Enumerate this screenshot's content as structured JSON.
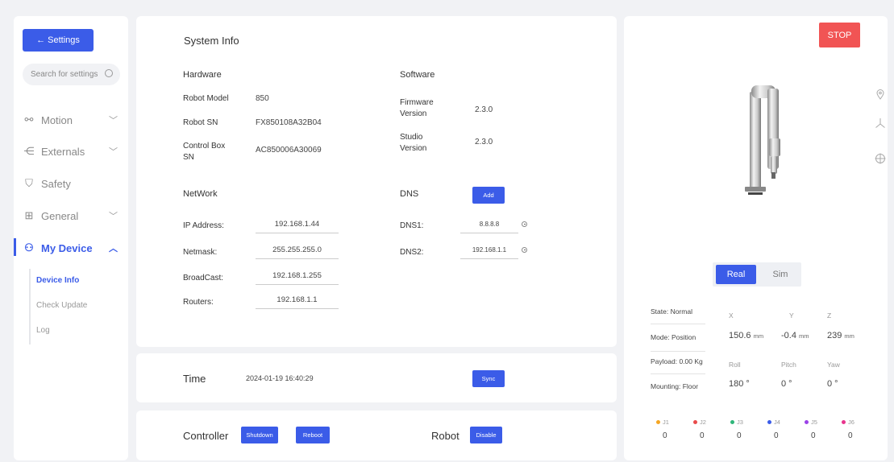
{
  "sidebar": {
    "back_label": "← Settings",
    "search_placeholder": "Search for settings",
    "nav": [
      {
        "label": "Motion",
        "icon": "route-icon",
        "glyph": "⚯",
        "chevron": "﹀"
      },
      {
        "label": "Externals",
        "icon": "plug-icon",
        "glyph": "⋲",
        "chevron": "﹀"
      },
      {
        "label": "Safety",
        "icon": "shield-check-icon",
        "glyph": "⛉",
        "chevron": ""
      },
      {
        "label": "General",
        "icon": "grid-icon",
        "glyph": "⊞",
        "chevron": "﹀"
      },
      {
        "label": "My Device",
        "icon": "user-icon",
        "glyph": "⚇",
        "chevron": "︿"
      }
    ],
    "sub_items": [
      "Device Info",
      "Check Update",
      "Log"
    ]
  },
  "system_info": {
    "title": "System Info",
    "hardware": {
      "heading": "Hardware",
      "rows": [
        {
          "label": "Robot Model",
          "value": "850"
        },
        {
          "label": "Robot SN",
          "value": "FX850108A32B04"
        },
        {
          "label": "Control Box SN",
          "value": "AC850006A30069"
        }
      ]
    },
    "software": {
      "heading": "Software",
      "rows": [
        {
          "label": "Firmware Version",
          "value": "2.3.0"
        },
        {
          "label": "Studio Version",
          "value": "2.3.0"
        }
      ]
    },
    "network": {
      "heading": "NetWork",
      "rows": [
        {
          "label": "IP Address:",
          "value": "192.168.1.44"
        },
        {
          "label": "Netmask:",
          "value": "255.255.255.0"
        },
        {
          "label": "BroadCast:",
          "value": "192.168.1.255"
        },
        {
          "label": "Routers:",
          "value": "192.168.1.1"
        }
      ]
    },
    "dns": {
      "heading": "DNS",
      "add_label": "Add",
      "rows": [
        {
          "label": "DNS1:",
          "value": "8.8.8.8"
        },
        {
          "label": "DNS2:",
          "value": "192.168.1.1"
        }
      ]
    }
  },
  "time": {
    "label": "Time",
    "value": "2024-01-19 16:40:29",
    "sync_label": "Sync"
  },
  "controller": {
    "label": "Controller",
    "shutdown_label": "Shutdown",
    "reboot_label": "Reboot",
    "robot_label": "Robot",
    "disable_label": "Disable"
  },
  "right_panel": {
    "stop_label": "STOP",
    "mode_real": "Real",
    "mode_sim": "Sim",
    "status": {
      "state": "State: Normal",
      "mode": "Mode: Position",
      "payload": "Payload: 0.00 Kg",
      "mounting": "Mounting: Floor"
    },
    "pose": {
      "x_label": "X",
      "x_value": "150.6",
      "x_unit": "mm",
      "y_label": "Y",
      "y_value": "-0.4",
      "y_unit": "mm",
      "z_label": "Z",
      "z_value": "239",
      "z_unit": "mm",
      "roll_label": "Roll",
      "roll_value": "180 °",
      "pitch_label": "Pitch",
      "pitch_value": "0 °",
      "yaw_label": "Yaw",
      "yaw_value": "0 °"
    },
    "joints": [
      {
        "label": "J1",
        "value": "0",
        "color": "#f5a623"
      },
      {
        "label": "J2",
        "value": "0",
        "color": "#e94b4b"
      },
      {
        "label": "J3",
        "value": "0",
        "color": "#2fb67a"
      },
      {
        "label": "J4",
        "value": "0",
        "color": "#3b5ce8"
      },
      {
        "label": "J5",
        "value": "0",
        "color": "#9b42e8"
      },
      {
        "label": "J6",
        "value": "0",
        "color": "#e8358d"
      }
    ]
  }
}
